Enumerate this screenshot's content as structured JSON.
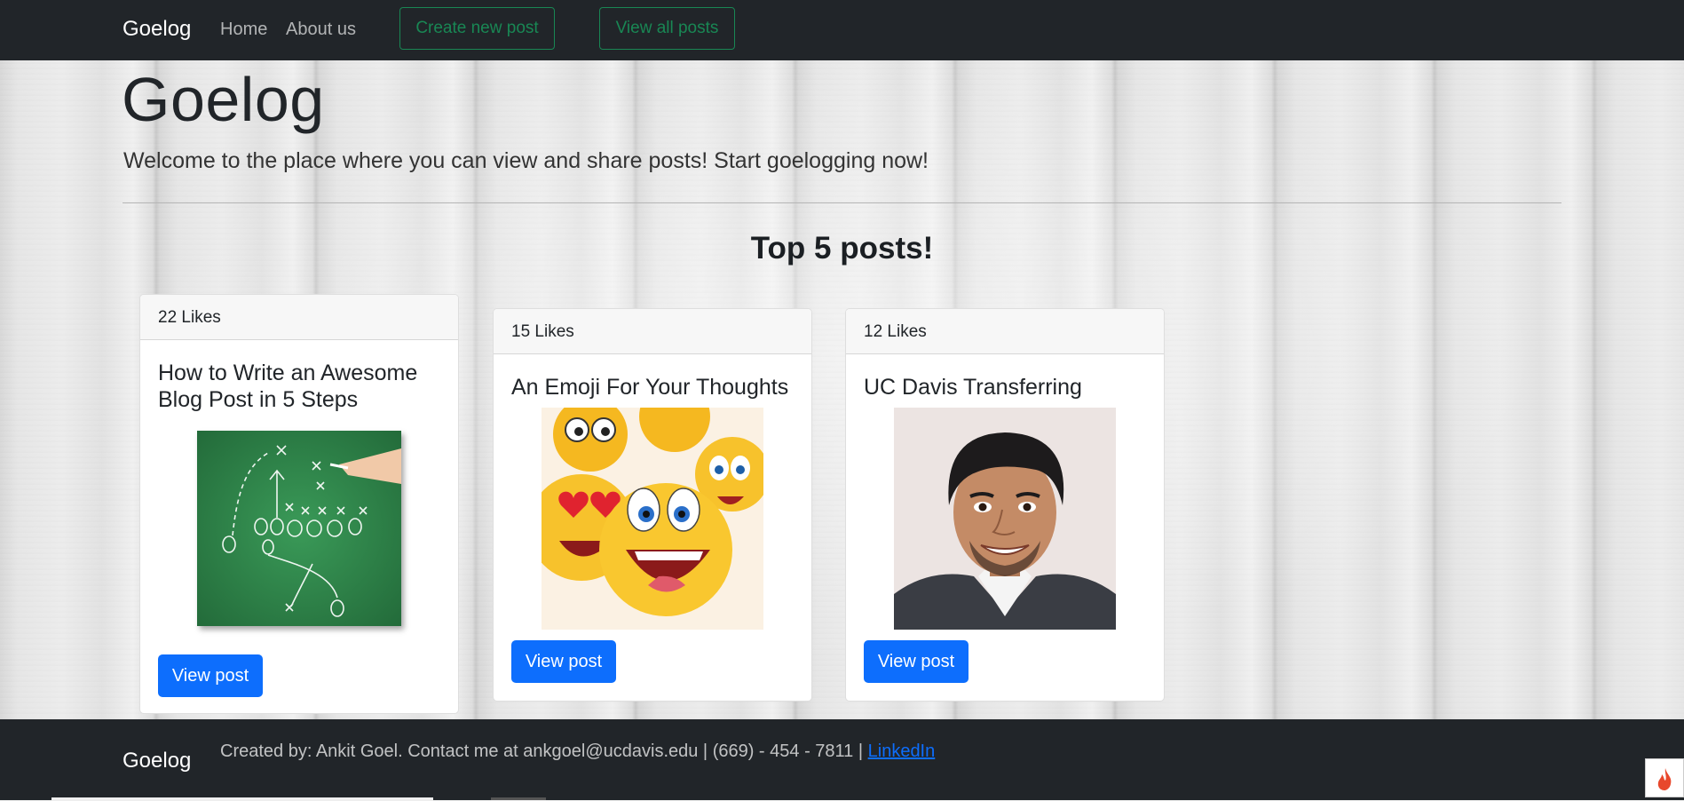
{
  "navbar": {
    "brand": "Goelog",
    "links": [
      {
        "label": "Home"
      },
      {
        "label": "About us"
      }
    ],
    "create_button": "Create new post",
    "view_all_button": "View all posts"
  },
  "hero": {
    "title": "Goelog",
    "lead": "Welcome to the place where you can view and share posts! Start goelogging now!"
  },
  "section": {
    "heading": "Top 5 posts!"
  },
  "posts": [
    {
      "likes": "22 Likes",
      "title": "How to Write an Awesome Blog Post in 5 Steps",
      "image": "chalkboard-play-diagram",
      "button": "View post"
    },
    {
      "likes": "15 Likes",
      "title": "An Emoji For Your Thoughts",
      "image": "emoji-faces",
      "button": "View post"
    },
    {
      "likes": "12 Likes",
      "title": "UC Davis Transferring",
      "image": "author-portrait",
      "button": "View post"
    }
  ],
  "footer": {
    "brand": "Goelog",
    "text": "Created by: Ankit Goel. Contact me at ankgoel@ucdavis.edu | (669) - 454 - 7811 |",
    "link_label": "LinkedIn"
  },
  "colors": {
    "navbar_bg": "#212529",
    "success": "#198754",
    "primary": "#0d6efd"
  }
}
